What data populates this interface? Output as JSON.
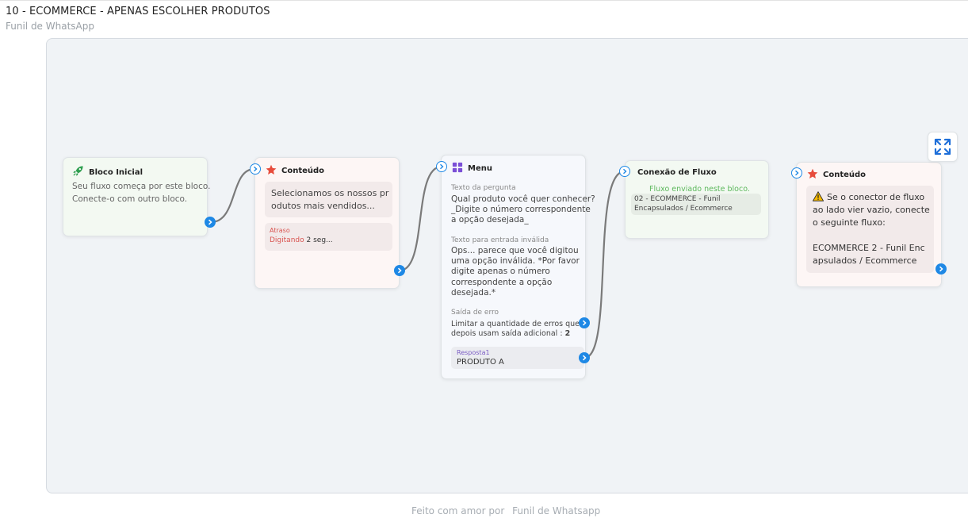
{
  "page": {
    "title": "10 - ECOMMERCE - APENAS ESCOLHER PRODUTOS",
    "subtitle": "Funil de WhatsApp"
  },
  "blocks": {
    "start": {
      "title": "Bloco Inicial",
      "icon": "rocket-icon",
      "text_line1": "Seu fluxo começa por este bloco.",
      "text_line2": "Conecte-o com outro bloco."
    },
    "content1": {
      "title": "Conteúdo",
      "icon": "star-icon",
      "message_line1": "Selecionamos os nossos pr",
      "message_line2": "odutos mais vendidos...",
      "delay_label": "Atraso",
      "delay_prefix": "Digitando",
      "delay_value": "2 seg..."
    },
    "menu": {
      "title": "Menu",
      "icon": "grid-icon",
      "question_label": "Texto da pergunta",
      "question_lines": [
        "Qual produto você quer conhecer?",
        "_Digite o número correspondente",
        "a opção desejada_"
      ],
      "invalid_label": "Texto para entrada inválida",
      "invalid_lines": [
        "Ops... parece que você digitou",
        "uma opção inválida. *Por favor",
        "digite apenas o número",
        "correspondente a opção",
        "desejada.*"
      ],
      "error_label": "Saída de erro",
      "error_line1": "Limitar a quantidade de erros que",
      "error_line2_prefix": "depois usam saída adicional :",
      "error_limit": "2",
      "answer_label": "Resposta1",
      "answer_value": "PRODUTO A"
    },
    "flow": {
      "title": "Conexão de Fluxo",
      "status": "Fluxo enviado neste bloco.",
      "flow_line1": "02 - ECOMMERCE - Funil",
      "flow_line2": "Encapsulados / Ecommerce"
    },
    "content2": {
      "title": "Conteúdo",
      "icon": "star-icon",
      "warning_icon": "warning-icon",
      "lines": [
        "Se o conector de fluxo",
        "ao lado vier vazio, conecte",
        "o seguinte fluxo:"
      ],
      "flow_line1": "ECOMMERCE 2 - Funil Enc",
      "flow_line2": "apsulados / Ecommerce"
    }
  },
  "footer": {
    "prefix": "Feito com amor por",
    "brand": "Funil de Whatsapp"
  },
  "colors": {
    "port_blue": "#1e88e5",
    "start_bg": "#f3f9f2",
    "content_bg": "#fdf6f5",
    "menu_bg": "#f6f8fc",
    "delay_red": "#d9534f",
    "status_green": "#5cb85c",
    "answer_purple": "#7b5cc4",
    "star_red": "#e74c3c",
    "rocket_green": "#2e9e4f"
  }
}
